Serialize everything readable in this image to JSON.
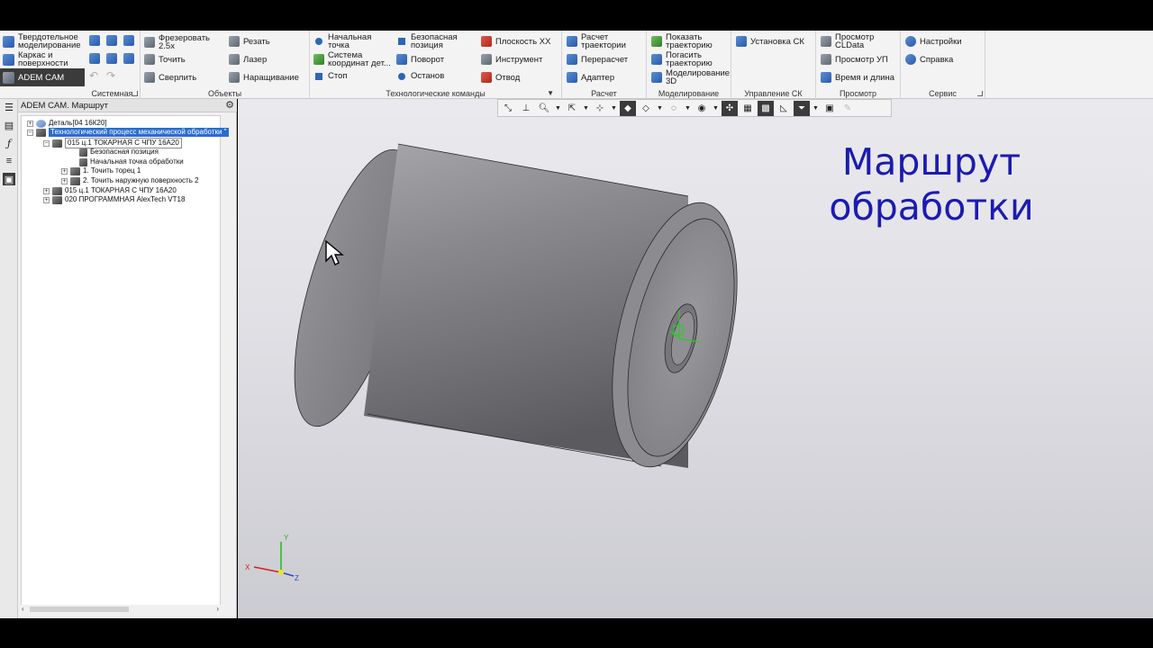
{
  "ribbon": {
    "modes": [
      {
        "label": "Твердотельное моделирование",
        "icon": "solid-modeling-icon"
      },
      {
        "label": "Каркас и поверхности",
        "icon": "wireframe-surfaces-icon"
      },
      {
        "label": "ADEM CAM",
        "icon": "adem-cam-icon",
        "active": true
      }
    ],
    "groups": {
      "system": "Системная",
      "objects": "Объекты",
      "tech": "Технологические команды",
      "calc": "Расчет",
      "modeling": "Моделирование",
      "cs": "Управление СК",
      "view": "Просмотр",
      "service": "Сервис"
    },
    "objects": {
      "mill": "Фрезеровать 2.5x",
      "turn": "Точить",
      "drill": "Сверлить",
      "cut": "Резать",
      "laser": "Лазер",
      "build": "Наращивание"
    },
    "tech": {
      "start_point": "Начальная точка",
      "coord_system": "Система координат дет...",
      "stop": "Стоп",
      "safe_pos": "Безопасная позиция",
      "rotate": "Поворот",
      "halt": "Останов",
      "plane": "Плоскость XX",
      "tool": "Инструмент",
      "retract": "Отвод"
    },
    "calc": {
      "traj": "Расчет траектории",
      "recalc": "Перерасчет",
      "adapter": "Адаптер"
    },
    "modeling": {
      "show": "Показать траекторию",
      "hide": "Погасить траекторию",
      "sim3d": "Моделирование 3D"
    },
    "cs": {
      "set": "Установка СК"
    },
    "view": {
      "cldata": "Просмотр CLData",
      "up": "Просмотр УП",
      "time": "Время и длина"
    },
    "service": {
      "settings": "Настройки",
      "help": "Справка"
    }
  },
  "tree": {
    "header": "ADEM CAM. Маршрут",
    "nodes": [
      {
        "label": "Деталь[04 16К20]"
      },
      {
        "label": "Технологический процесс механической обработки \""
      },
      {
        "label": "015 ц.1 ТОКАРНАЯ С ЧПУ 16А20"
      },
      {
        "label": "Безопасная позиция"
      },
      {
        "label": "Начальная точка обработки"
      },
      {
        "label": "1.  Точить торец 1"
      },
      {
        "label": "2.  Точить наружную поверхность 2"
      },
      {
        "label": "015 ц.1 ТОКАРНАЯ С ЧПУ 16А20"
      },
      {
        "label": "020  ПРОГРАММНАЯ AlexTech VT18"
      }
    ]
  },
  "viewport": {
    "overlay_title": "Маршрут обработки",
    "axis_labels": {
      "x": "X",
      "y": "Y",
      "z": "Z"
    },
    "colors": {
      "title": "#1b1bb0",
      "part": "#8a8a8e",
      "cs": "#22d022"
    }
  }
}
